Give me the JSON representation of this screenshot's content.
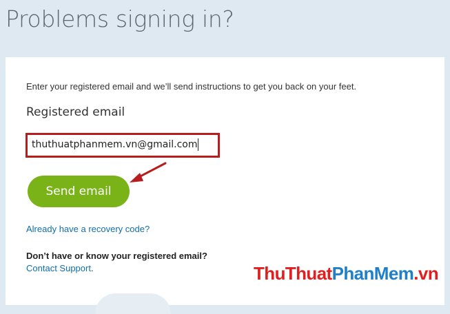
{
  "page": {
    "title": "Problems signing in?"
  },
  "form": {
    "intro_text": "Enter your registered email and we’ll send instructions to get you back on your feet.",
    "email_label": "Registered email",
    "email_value": "thuthuatphanmem.vn@gmail.com",
    "send_button_label": "Send email",
    "recovery_link_label": "Already have a recovery code?",
    "no_email_question": "Don’t have or know your registered email?",
    "support_link_label": "Contact Support",
    "support_suffix": "."
  },
  "watermark": {
    "part1": "ThuThuat",
    "part2": "PhanMem",
    "part3": ".vn"
  },
  "colors": {
    "page_background": "#dfe9f1",
    "title_text": "#5b6770",
    "button_green": "#7ab317",
    "link_blue": "#0f6fae",
    "annotation_red": "#b81c1c",
    "watermark_red": "#e02020",
    "watermark_blue": "#1f7fc9"
  }
}
